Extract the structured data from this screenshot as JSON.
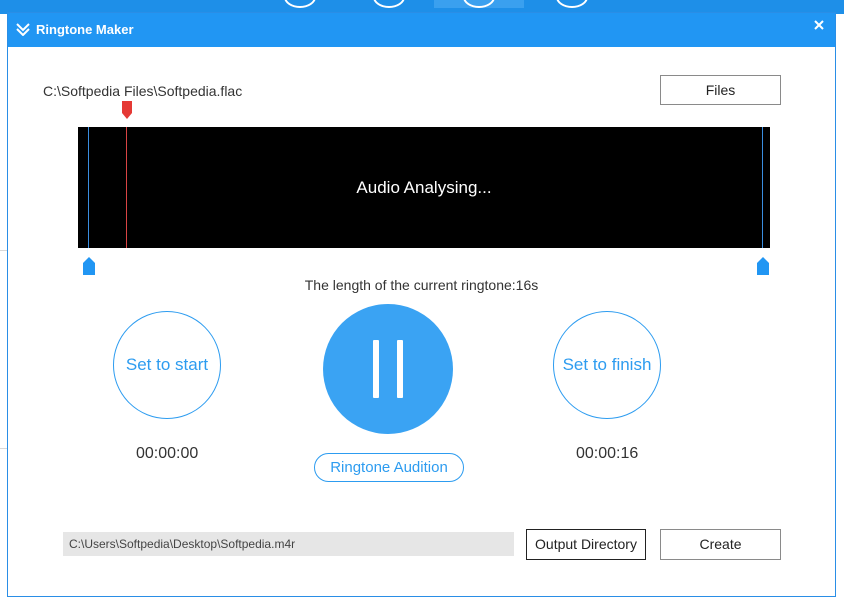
{
  "dialog": {
    "title": "Ringtone Maker",
    "close_icon": "close-icon",
    "title_icon": "chevron-logo-icon"
  },
  "file": {
    "path": "C:\\Softpedia Files\\Softpedia.flac",
    "files_button": "Files"
  },
  "waveform": {
    "status": "Audio Analysing..."
  },
  "ringtone": {
    "length_text": "The length of the current ringtone:16s",
    "set_start_label": "Set to start",
    "set_finish_label": "Set to finish",
    "start_time": "00:00:00",
    "end_time": "00:00:16",
    "audition_label": "Ringtone Audition",
    "pause_icon": "pause-icon"
  },
  "output": {
    "path_value": "C:\\Users\\Softpedia\\Desktop\\Softpedia.m4r",
    "directory_button": "Output Directory",
    "create_button": "Create"
  },
  "colors": {
    "accent": "#2196f3",
    "playhead": "#e53935",
    "waveform_bg": "#000000"
  }
}
